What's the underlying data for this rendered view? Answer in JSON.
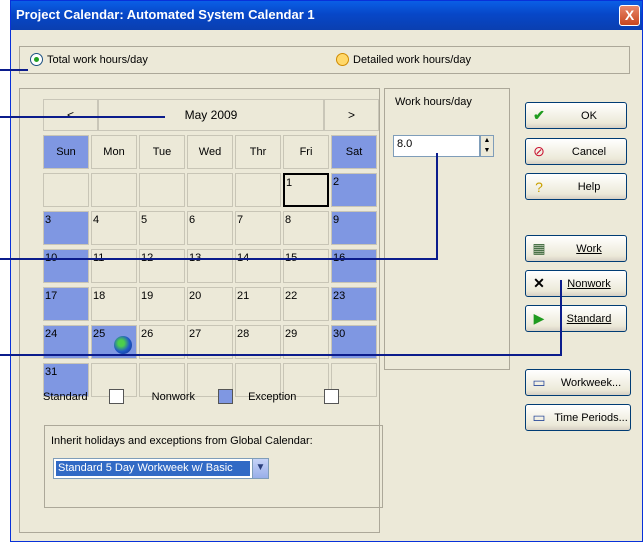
{
  "window": {
    "title": "Project Calendar: Automated System Calendar 1",
    "close_glyph": "X"
  },
  "mode": {
    "option1": "Total work hours/day",
    "option2": "Detailed work hours/day",
    "selected": "option1"
  },
  "calendar": {
    "prev": "<",
    "next": ">",
    "month": "May 2009",
    "days": [
      "Sun",
      "Mon",
      "Tue",
      "Wed",
      "Thr",
      "Fri",
      "Sat"
    ],
    "weeks": [
      [
        "",
        "",
        "",
        "",
        "",
        "1",
        "2"
      ],
      [
        "3",
        "4",
        "5",
        "6",
        "7",
        "8",
        "9"
      ],
      [
        "10",
        "11",
        "12",
        "13",
        "14",
        "15",
        "16"
      ],
      [
        "17",
        "18",
        "19",
        "20",
        "21",
        "22",
        "23"
      ],
      [
        "24",
        "25",
        "26",
        "27",
        "28",
        "29",
        "30"
      ],
      [
        "31",
        "",
        "",
        "",
        "",
        "",
        ""
      ]
    ]
  },
  "legend": {
    "standard": "Standard",
    "nonwork": "Nonwork",
    "exception": "Exception"
  },
  "inherit": {
    "label": "Inherit holidays and exceptions from Global Calendar:",
    "value": "Standard 5 Day Workweek w/ Basic"
  },
  "hours": {
    "label": "Work hours/day",
    "value": "8.0"
  },
  "buttons": {
    "ok": "OK",
    "cancel": "Cancel",
    "help": "Help",
    "work": "Work",
    "nonwork": "Nonwork",
    "standard": "Standard",
    "workweek": "Workweek...",
    "time_periods": "Time Periods..."
  },
  "colors": {
    "nonwork_blue": "#7f97e2",
    "titlebar": "#0747c8"
  }
}
